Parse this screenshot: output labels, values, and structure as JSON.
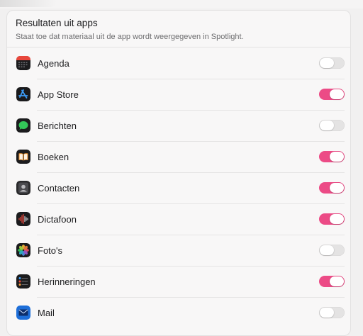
{
  "section": {
    "title": "Resultaten uit apps",
    "subtitle": "Staat toe dat materiaal uit de app wordt weergegeven in Spotlight."
  },
  "accent_color": "#ec4b86",
  "apps": [
    {
      "label": "Agenda",
      "icon": "calendar-icon",
      "enabled": false
    },
    {
      "label": "App Store",
      "icon": "app-store-icon",
      "enabled": true
    },
    {
      "label": "Berichten",
      "icon": "messages-icon",
      "enabled": false
    },
    {
      "label": "Boeken",
      "icon": "books-icon",
      "enabled": true
    },
    {
      "label": "Contacten",
      "icon": "contacts-icon",
      "enabled": true
    },
    {
      "label": "Dictafoon",
      "icon": "voice-memos-icon",
      "enabled": true
    },
    {
      "label": "Foto's",
      "icon": "photos-icon",
      "enabled": false
    },
    {
      "label": "Herinneringen",
      "icon": "reminders-icon",
      "enabled": true
    },
    {
      "label": "Mail",
      "icon": "mail-icon",
      "enabled": false
    }
  ]
}
